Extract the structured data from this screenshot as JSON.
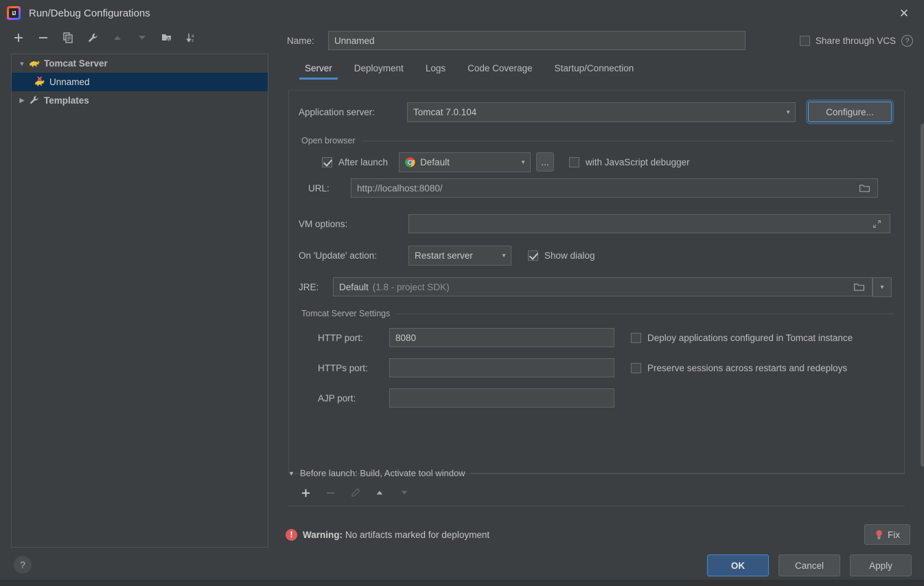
{
  "window": {
    "title": "Run/Debug Configurations",
    "app_icon": "intellij-idea-icon",
    "close_label": "✕"
  },
  "tree_toolbar": {
    "items": [
      {
        "name": "add-configuration",
        "icon": "plus-icon",
        "enabled": true
      },
      {
        "name": "remove-configuration",
        "icon": "minus-icon",
        "enabled": true
      },
      {
        "name": "copy-configuration",
        "icon": "copy-icon",
        "enabled": true
      },
      {
        "name": "edit-templates",
        "icon": "wrench-icon",
        "enabled": true
      },
      {
        "name": "move-up",
        "icon": "arrow-up-icon",
        "enabled": false
      },
      {
        "name": "move-down",
        "icon": "arrow-down-icon",
        "enabled": false
      },
      {
        "name": "create-folder",
        "icon": "folder-add-icon",
        "enabled": true
      },
      {
        "name": "sort-alphabetically",
        "icon": "sort-az-icon",
        "enabled": true
      }
    ]
  },
  "tree": {
    "nodes": [
      {
        "label": "Tomcat Server",
        "icon": "tomcat-icon",
        "expanded": true,
        "level": 1,
        "selected": false
      },
      {
        "label": "Unnamed",
        "icon": "tomcat-error-icon",
        "expanded": null,
        "level": 2,
        "selected": true
      },
      {
        "label": "Templates",
        "icon": "wrench-icon",
        "expanded": false,
        "level": 1,
        "selected": false
      }
    ]
  },
  "name_row": {
    "label": "Name:",
    "value": "Unnamed",
    "placeholder": "Unnamed"
  },
  "share": {
    "label": "Share through VCS",
    "checked": false,
    "help_icon": "question-mark-icon",
    "help_glyph": "?"
  },
  "tabs": [
    {
      "label": "Server",
      "active": true
    },
    {
      "label": "Deployment",
      "active": false
    },
    {
      "label": "Logs",
      "active": false
    },
    {
      "label": "Code Coverage",
      "active": false
    },
    {
      "label": "Startup/Connection",
      "active": false
    }
  ],
  "server_tab": {
    "application_server": {
      "label": "Application server:",
      "value": "Tomcat 7.0.104",
      "configure_button": "Configure...",
      "configure_focused": true
    },
    "open_browser": {
      "group_label": "Open browser",
      "after_launch": {
        "label": "After launch",
        "checked": true
      },
      "browser": {
        "value": "Default",
        "icon": "chrome-icon"
      },
      "ellipsis_button": "...",
      "js_debugger": {
        "label": "with JavaScript debugger",
        "checked": false
      },
      "url": {
        "label": "URL:",
        "value": "http://localhost:8080/",
        "browse_icon": "folder-icon"
      }
    },
    "vm_options": {
      "label": "VM options:",
      "value": "",
      "expand_icon": "expand-diagonal-icon"
    },
    "on_update_action": {
      "label": "On 'Update' action:",
      "value": "Restart server",
      "show_dialog": {
        "label": "Show dialog",
        "checked": true
      }
    },
    "jre": {
      "label": "JRE:",
      "value": "Default",
      "value_hint": "(1.8 - project SDK)",
      "browse_icon": "folder-icon",
      "dropdown_icon": "chevron-down-icon"
    },
    "tomcat_settings": {
      "group_label": "Tomcat Server Settings",
      "http_port": {
        "label": "HTTP port:",
        "value": "8080"
      },
      "https_port": {
        "label": "HTTPs port:",
        "value": ""
      },
      "ajp_port": {
        "label": "AJP port:",
        "value": ""
      },
      "deploy_apps": {
        "label": "Deploy applications configured in Tomcat instance",
        "checked": false
      },
      "preserve_sessions": {
        "label": "Preserve sessions across restarts and redeploys",
        "checked": false
      }
    }
  },
  "before_launch": {
    "header": "Before launch: Build, Activate tool window",
    "expanded": true,
    "toolbar": [
      {
        "name": "add-task",
        "icon": "plus-icon",
        "enabled": true
      },
      {
        "name": "remove-task",
        "icon": "minus-icon",
        "enabled": false
      },
      {
        "name": "edit-task",
        "icon": "pencil-icon",
        "enabled": false
      },
      {
        "name": "move-task-up",
        "icon": "arrow-up-icon",
        "enabled": true
      },
      {
        "name": "move-task-down",
        "icon": "arrow-down-icon",
        "enabled": false
      }
    ]
  },
  "warning": {
    "icon": "error-circle-icon",
    "prefix": "Warning:",
    "message": "No artifacts marked for deployment",
    "fix_button": "Fix",
    "fix_icon": "lightbulb-error-icon"
  },
  "bottom": {
    "help_glyph": "?",
    "buttons": [
      {
        "label": "OK",
        "primary": true
      },
      {
        "label": "Cancel",
        "primary": false
      },
      {
        "label": "Apply",
        "primary": false
      }
    ]
  },
  "colors": {
    "background": "#3c3f41",
    "panel_border": "#4b4f51",
    "field_bg": "#45494a",
    "accent_blue": "#4a88c7",
    "primary_button": "#365880",
    "selection": "#0d3050",
    "warning_red": "#db5c5c",
    "text": "#bbbbbb"
  }
}
